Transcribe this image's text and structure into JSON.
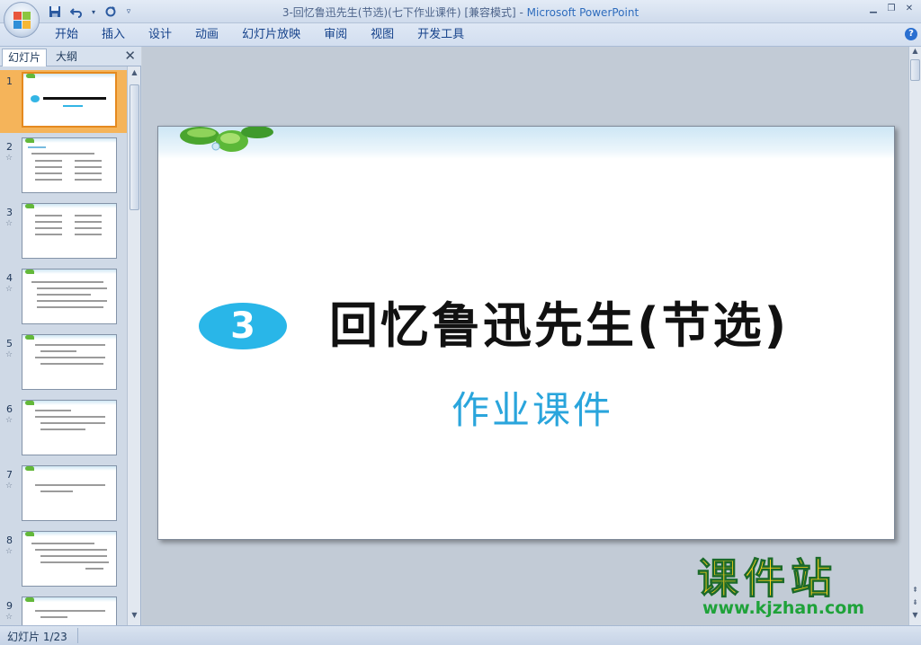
{
  "window": {
    "title_doc": "3-回忆鲁迅先生(节选)(七下作业课件) [兼容模式] - ",
    "title_app": "Microsoft PowerPoint"
  },
  "quick_access": {
    "save_icon": "save-icon",
    "undo_icon": "undo-icon",
    "redo_icon": "redo-icon"
  },
  "ribbon": {
    "tabs": [
      "开始",
      "插入",
      "设计",
      "动画",
      "幻灯片放映",
      "审阅",
      "视图",
      "开发工具"
    ]
  },
  "pane": {
    "tab_slides": "幻灯片",
    "tab_outline": "大纲",
    "thumbnails": [
      {
        "num": "1",
        "star": ""
      },
      {
        "num": "2",
        "star": "☆"
      },
      {
        "num": "3",
        "star": "☆"
      },
      {
        "num": "4",
        "star": "☆"
      },
      {
        "num": "5",
        "star": "☆"
      },
      {
        "num": "6",
        "star": "☆"
      },
      {
        "num": "7",
        "star": "☆"
      },
      {
        "num": "8",
        "star": "☆"
      },
      {
        "num": "9",
        "star": "☆"
      }
    ]
  },
  "slide": {
    "number": "3",
    "title": "回忆鲁迅先生(节选)",
    "subtitle": "作业课件"
  },
  "watermark": {
    "line1": "课件站",
    "line2": "www.kjzhan.com"
  },
  "status": {
    "text": "幻灯片 1/23"
  },
  "colors": {
    "accent_blue": "#29b6e8",
    "selection_orange": "#f5b45a",
    "watermark_yellow": "#ffd21a",
    "watermark_green": "#1fa23a"
  }
}
